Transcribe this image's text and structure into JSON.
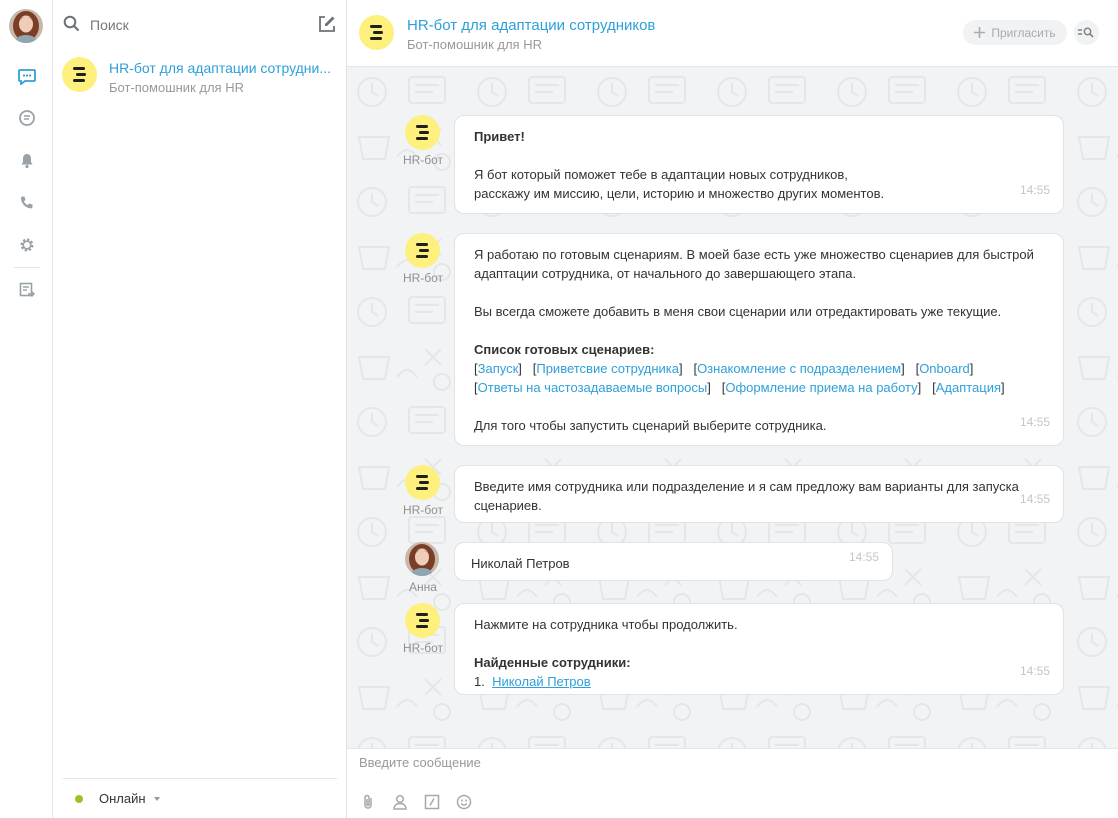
{
  "sidebar": {
    "icons": [
      "messages-icon",
      "open-lines-icon",
      "notifications-icon",
      "calls-icon",
      "settings-icon",
      "export-icon"
    ]
  },
  "chat_list": {
    "search_placeholder": "Поиск",
    "items": [
      {
        "name": "HR-бот для адаптации сотрудни...",
        "subtitle": "Бот-помошник для HR"
      }
    ],
    "status": {
      "label": "Онлайн",
      "color": "#9cc324"
    }
  },
  "dialog": {
    "title": "HR-бот для адаптации сотрудников",
    "description": "Бот-помошник для HR",
    "invite_label": "Пригласить",
    "accent": "#2ea0d8",
    "bot_color": "#fdf07d",
    "messages": [
      {
        "author": "HR-бот",
        "time": "14:55",
        "greeting": "Привет!",
        "line1": "Я бот который поможет тебе в адаптации новых сотрудников,",
        "line2": "расскажу им миссию, цели, историю и множество других моментов."
      },
      {
        "author": "HR-бот",
        "time": "14:55",
        "p1_line1": "Я работаю по готовым сценариям. В моей базе есть уже множество сценариев для быстрой",
        "p1_line2": "адаптации сотрудника, от начального до завершающего этапа.",
        "p2": "Вы всегда сможете добавить в меня свои сценарии или отредактировать уже текущие.",
        "list_title": "Список готовых сценариев:",
        "scenarios_row1": [
          "Запуск",
          "Приветсвие сотрудника",
          "Ознакомление с подразделением",
          "Onboard"
        ],
        "scenarios_row2": [
          "Ответы на частозадаваемые вопросы",
          "Оформление приема на работу",
          "Адаптация"
        ],
        "p3": "Для того чтобы запустить сценарий выберите сотрудника."
      },
      {
        "author": "HR-бот",
        "time": "14:55",
        "line1": "Введите имя сотрудника или подразделение и я сам предложу вам варианты для запуска",
        "line2": "сценариев."
      },
      {
        "author": "Анна",
        "time": "14:55",
        "text": "Николай Петров"
      },
      {
        "author": "HR-бот",
        "time": "14:55",
        "line1": "Нажмите на сотрудника чтобы продолжить.",
        "list_title": "Найденные сотрудники:",
        "item_num": "1.",
        "item_name": "Николай Петров"
      }
    ]
  },
  "input": {
    "placeholder": "Введите сообщение",
    "tools": [
      "attach-icon",
      "user-icon",
      "command-icon",
      "smile-icon"
    ]
  }
}
